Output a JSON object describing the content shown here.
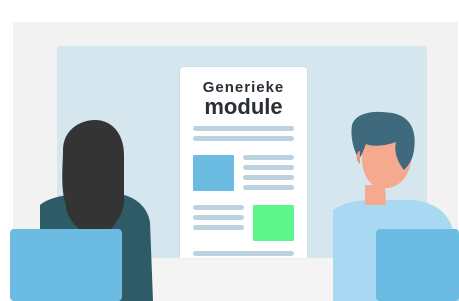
{
  "document": {
    "title_line1": "Generieke",
    "title_line2": "module"
  },
  "colors": {
    "background_panel": "#f2f2f2",
    "screen": "#d5e6ee",
    "paper": "#ffffff",
    "text_lines": "#bcd3df",
    "blue_block": "#6cbbe3",
    "green_block": "#5ef58d",
    "woman_hair": "#343434",
    "man_hair": "#3f6a7d",
    "skin": "#f5a98f",
    "man_shirt": "#a9d8f2",
    "woman_shirt": "#2f5b67",
    "chairs": "#6cbbe3"
  }
}
